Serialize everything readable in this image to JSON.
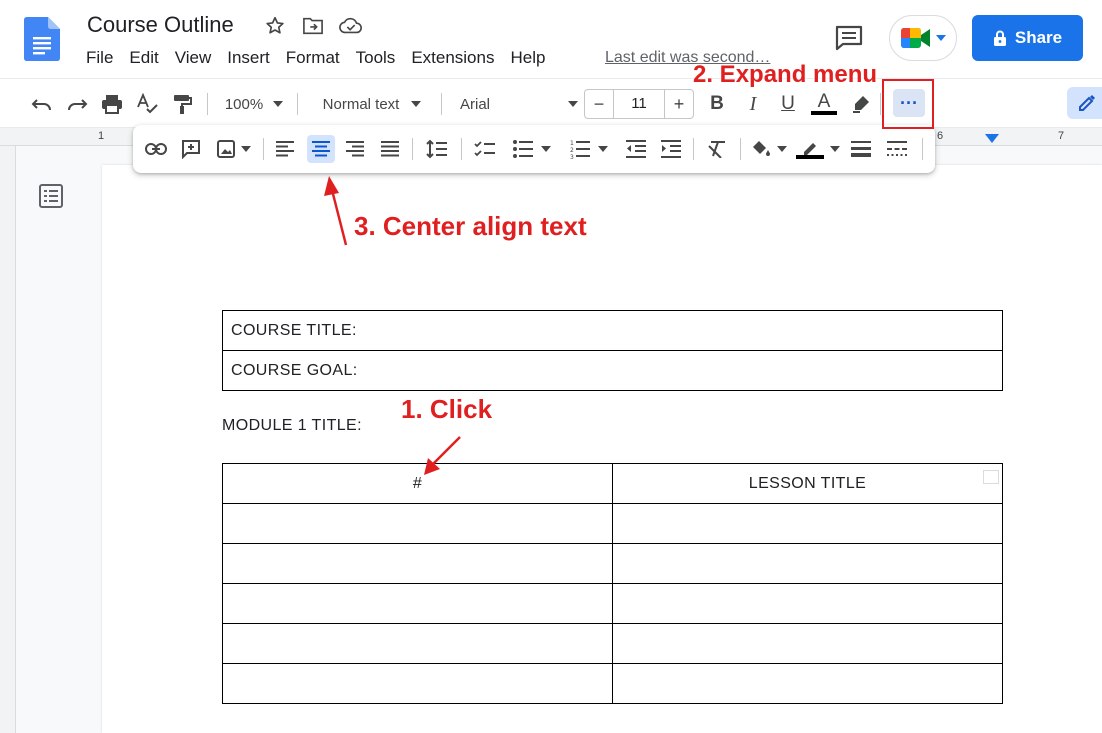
{
  "header": {
    "title": "Course Outline",
    "last_edit": "Last edit was second…",
    "share_label": "Share"
  },
  "menu": {
    "items": [
      "File",
      "Edit",
      "View",
      "Insert",
      "Format",
      "Tools",
      "Extensions",
      "Help"
    ]
  },
  "toolbar": {
    "zoom": "100%",
    "style": "Normal text",
    "font": "Arial",
    "font_size": "11",
    "minus": "−",
    "plus": "+",
    "bold": "B",
    "italic": "I",
    "underline": "U",
    "text_color": "A",
    "more": "···"
  },
  "ruler": {
    "marks": [
      "1",
      "6",
      "7"
    ]
  },
  "document": {
    "table1": [
      "COURSE TITLE:",
      "COURSE GOAL:"
    ],
    "module_title": "MODULE 1 TITLE:",
    "table2_headers": [
      "#",
      "LESSON TITLE"
    ]
  },
  "annotations": {
    "step1": "1. Click",
    "step2": "2. Expand menu",
    "step3": "3. Center align text"
  },
  "colors": {
    "accent": "#1a73e8",
    "annotation": "#e02020"
  }
}
